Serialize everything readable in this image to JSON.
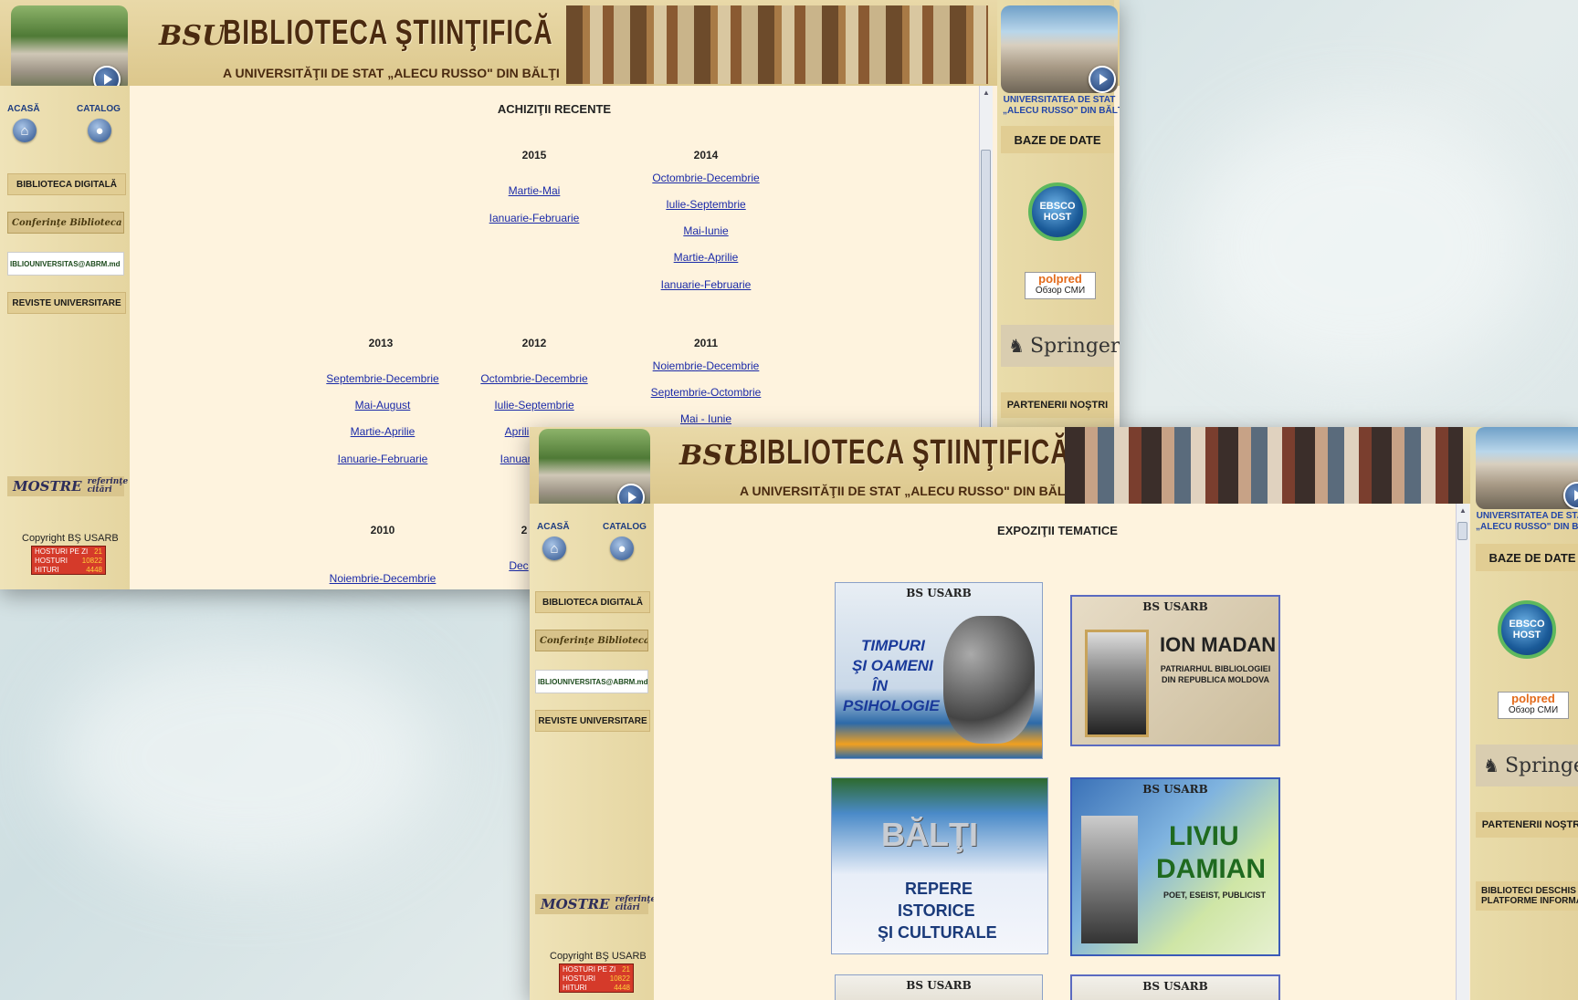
{
  "banner": {
    "logo": "BSU",
    "title": "BIBLIOTECA ŞTIINŢIFICĂ",
    "subtitle": "A UNIVERSITĂŢII DE STAT „ALECU RUSSO\" DIN BĂLŢI"
  },
  "left": {
    "home_label": "ACASĂ",
    "catalog_label": "CATALOG",
    "digital_library": "BIBLIOTECA DIGITALĂ",
    "conferences": "Conferinţe Biblioteca",
    "email": "IBLIOUNIVERSITAS@ABRM.md",
    "journals": "REVISTE UNIVERSITARE",
    "samples_main": "MOSTRE",
    "samples_sub1": "referinţe",
    "samples_sub2": "citări",
    "copyright": "Copyright BŞ USARB",
    "counter": {
      "label1": "HOSTURI PE ZI",
      "value1": "21",
      "label2": "HOSTURI",
      "value2": "10822",
      "label3": "HITURI",
      "value3": "4448"
    }
  },
  "right": {
    "univ_line1": "UNIVERSITATEA DE STAT",
    "univ_line2": "„ALECU RUSSO\" DIN BĂLŢI",
    "univ_line1_cut": "UNIVERSITATEA DE STAT",
    "univ_line2_cut": "„ALECU RUSSO\" DIN BAL",
    "databases": "BAZE DE DATE",
    "ebsco": "EBSCO HOST",
    "polpred_1": "polpred",
    "polpred_2": "Обзор СМИ",
    "springer": "Springer",
    "partners": "PARTENERII NOŞTRI",
    "partners_cut": "PARTENERII NOŞTRI",
    "open_libs_1": "BIBLIOTECI DESCHIS",
    "open_libs_2": "PLATFORME INFORMAŢIONAL"
  },
  "window1": {
    "section_title": "ACHIZIŢII RECENTE",
    "years": {
      "y2015": "2015",
      "y2014": "2014",
      "y2013": "2013",
      "y2012": "2012",
      "y2011": "2011",
      "y2010": "2010",
      "y2009_cut": "2"
    },
    "links": {
      "l2015_1": "Martie-Mai",
      "l2015_2": "Ianuarie-Februarie",
      "l2014_1": "Octombrie-Decembrie",
      "l2014_2": "Iulie-Septembrie",
      "l2014_3": "Mai-Iunie",
      "l2014_4": "Martie-Aprilie",
      "l2014_5": "Ianuarie-Februarie",
      "l2013_1": "Septembrie-Decembrie",
      "l2013_2": "Mai-August",
      "l2013_3": "Martie-Aprilie",
      "l2013_4": "Ianuarie-Februarie",
      "l2012_1": "Octombrie-Decembrie",
      "l2012_2": "Iulie-Septembrie",
      "l2012_3": "Aprili",
      "l2012_4": "Ianuari",
      "l2011_1": "Noiembrie-Decembrie",
      "l2011_2": "Septembrie-Octombrie",
      "l2011_3": "Mai - Iunie",
      "l2010_1": "Noiembrie-Decembrie",
      "l2009_1": "Dec"
    }
  },
  "window2": {
    "section_title": "EXPOZIŢII TEMATICE",
    "posters": {
      "p1_header": "BS USARB",
      "p1_title_1": "TIMPURI",
      "p1_title_2": "ŞI OAMENI",
      "p1_title_3": "ÎN",
      "p1_title_4": "PSIHOLOGIE",
      "p2_header": "BS USARB",
      "p2_title": "ION MADAN",
      "p2_sub1": "PATRIARHUL BIBLIOLOGIEI",
      "p2_sub2": "DIN REPUBLICA MOLDOVA",
      "p3_title": "BĂLŢI",
      "p3_sub1": "REPERE",
      "p3_sub2": "ISTORICE",
      "p3_sub3": "ŞI CULTURALE",
      "p4_header": "BS USARB",
      "p4_title1": "LIVIU",
      "p4_title2": "DAMIAN",
      "p4_sub": "POET, ESEIST, PUBLICIST",
      "p5_header": "BS USARB",
      "p6_header": "BS USARB"
    }
  }
}
